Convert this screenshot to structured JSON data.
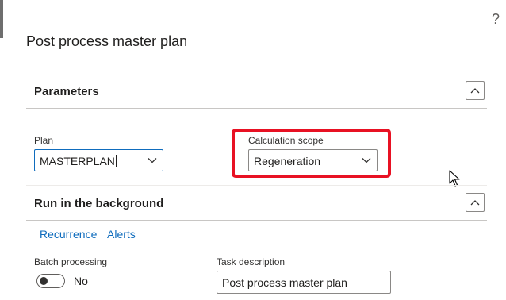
{
  "help": {
    "label": "?"
  },
  "panel": {
    "title": "Post process master plan"
  },
  "parameters": {
    "heading": "Parameters",
    "plan": {
      "label": "Plan",
      "value": "MASTERPLAN"
    },
    "calculation_scope": {
      "label": "Calculation scope",
      "value": "Regeneration"
    }
  },
  "background": {
    "heading": "Run in the background",
    "tabs": [
      "Recurrence",
      "Alerts"
    ],
    "batch_processing": {
      "label": "Batch processing",
      "state": "No"
    },
    "task_description": {
      "label": "Task description",
      "value": "Post process master plan"
    }
  },
  "icons": {
    "help": "question-mark-icon",
    "collapse": "chevron-up-icon",
    "dropdown": "chevron-down-icon",
    "cursor": "mouse-pointer-icon"
  },
  "colors": {
    "highlight_border": "#e81123",
    "link": "#0f6cbd",
    "divider": "#c8c6c4"
  }
}
